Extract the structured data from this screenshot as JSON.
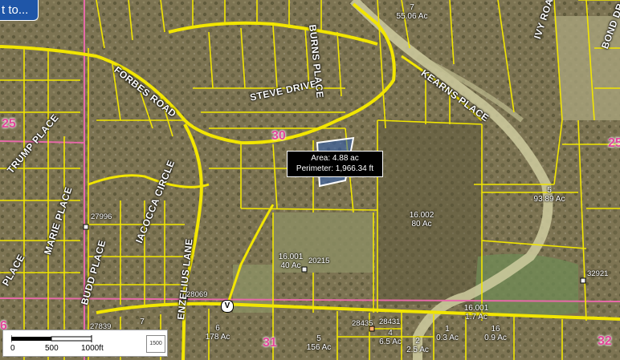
{
  "top_button": {
    "label": "t to..."
  },
  "measurement": {
    "area": "Area: 4.88 ac",
    "perimeter": "Perimeter: 1,966.34 ft"
  },
  "road_labels": {
    "steve_drive": "STEVE DRIVE",
    "burns_place": "BURNS PLACE",
    "forbes_road": "FORBES ROAD",
    "kearns_place": "KEARNS PLACE",
    "trump_place": "TRUMP PLACE",
    "marie_place": "MARIE PLACE",
    "iacocca_circle": "IACOCCA CIRCLE",
    "budd_place": "BUDD PLACE",
    "enzelius_lane": "ENZELIUS LANE",
    "bond_drive": "BOND DR",
    "ivy_road": "IVY ROAD",
    "place_left": "PLACE"
  },
  "section_numbers": {
    "s25_left": "25",
    "s25_right": "25",
    "s30": "30",
    "s31": "31",
    "s32": "32",
    "s36": "6"
  },
  "parcels": {
    "p7": {
      "id": "7",
      "acres": "55.06 Ac"
    },
    "p5": {
      "id": "5",
      "acres": "93.89 Ac"
    },
    "p16002": {
      "id": "16.002",
      "acres": "80 Ac"
    },
    "p16001a": {
      "id": "16.001",
      "acres": "40 Ac"
    },
    "p16001b": {
      "id": "16.001",
      "acres": "1.7 Ac"
    },
    "p6": {
      "id": "6",
      "acres": "178 Ac"
    },
    "p5b": {
      "id": "5",
      "acres": "156 Ac"
    },
    "p7b": {
      "id": "7",
      "acres": ""
    },
    "p4": {
      "id": "4",
      "acres": "6.5 Ac"
    },
    "p2": {
      "id": "2",
      "acres": "2.5 Ac"
    },
    "p1": {
      "id": "1",
      "acres": "0.3 Ac"
    },
    "p16": {
      "id": "16",
      "acres": "0.9 Ac"
    }
  },
  "addresses": {
    "a27996": "27996",
    "a20215": "20215",
    "a28069": "28069",
    "a28435": "28435",
    "a28431": "28431",
    "a32921": "32921",
    "a27839": "27839"
  },
  "route_marker": "V",
  "scale": {
    "zero": "0",
    "mid": "500",
    "end": "1000ft",
    "ratio": "1500"
  },
  "colors": {
    "parcel_line": "#f2e600",
    "section_line": "#e66aa8",
    "selection": "#1f56a8",
    "water": "#cfcda0"
  }
}
